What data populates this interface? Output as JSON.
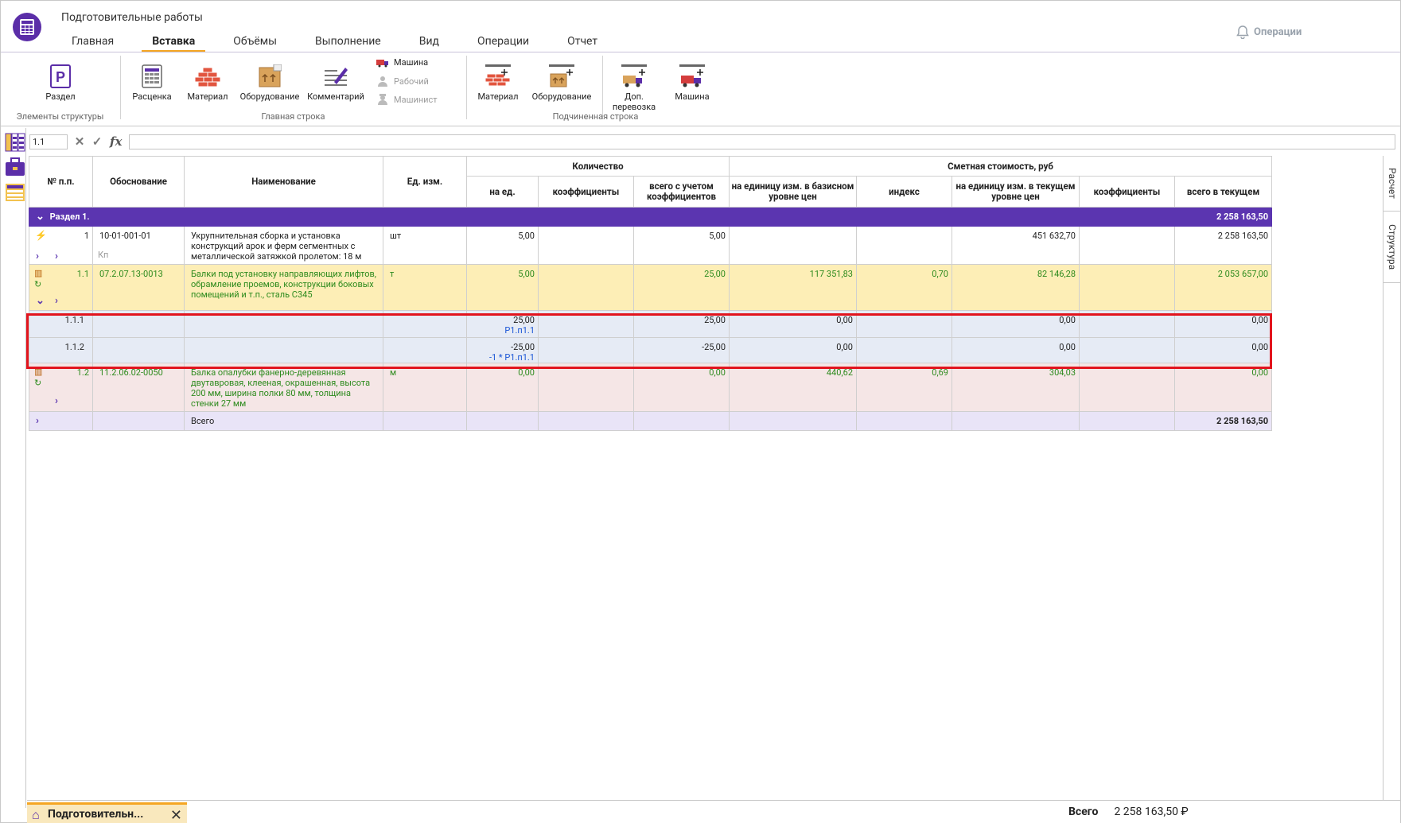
{
  "app": {
    "title": "Подготовительные работы"
  },
  "tabs": [
    "Главная",
    "Вставка",
    "Объёмы",
    "Выполнение",
    "Вид",
    "Операции",
    "Отчет"
  ],
  "operations_label": "Операции",
  "ribbon": {
    "section": "Раздел",
    "group1_label": "Элементы структуры",
    "rate": "Расценка",
    "material": "Материал",
    "equipment": "Оборудование",
    "comment": "Комментарий",
    "machine": "Машина",
    "worker": "Рабочий",
    "machinist": "Машинист",
    "group2_label": "Главная строка",
    "sub_material": "Материал",
    "sub_equipment": "Оборудование",
    "sub_transport": "Доп.\nперевозка",
    "sub_machine": "Машина",
    "group3_label": "Подчиненная строка"
  },
  "formula": {
    "cell_ref": "1.1",
    "value": ""
  },
  "right_tabs": [
    "Расчет",
    "Структура"
  ],
  "grid": {
    "headers": {
      "num": "№ п.п.",
      "basis": "Обоснование",
      "name": "Наименование",
      "unit": "Ед. изм.",
      "qty_group": "Количество",
      "qty_per": "на ед.",
      "qty_coef": "коэффициенты",
      "qty_total": "всего с учетом коэффициентов",
      "cost_group": "Сметная стоимость, руб",
      "cost_base": "на единицу изм. в базисном уровне цен",
      "cost_index": "индекс",
      "cost_cur": "на единицу изм. в текущем уровне цен",
      "cost_coef": "коэффициенты",
      "cost_total": "всего в текущем"
    },
    "section": {
      "title": "Раздел 1.",
      "total": "2 258 163,50"
    },
    "row1": {
      "num": "1",
      "basis": "10-01-001-01",
      "kp": "Кп",
      "name": "Укрупнительная сборка и установка конструкций арок и ферм сегментных с металлической затяжкой пролетом: 18 м",
      "unit": "шт",
      "qty_per": "5,00",
      "qty_total": "5,00",
      "cost_cur": "451 632,70",
      "total": "2 258 163,50"
    },
    "row11": {
      "num": "1.1",
      "basis": "07.2.07.13-0013",
      "name": "Балки под установку направляющих лифтов, обрамление проемов, конструкции боковых помещений и т.п., сталь С345",
      "unit": "т",
      "qty_per": "5,00",
      "qty_total": "25,00",
      "cost_base": "117 351,83",
      "index": "0,70",
      "cost_cur": "82 146,28",
      "total": "2 053 657,00"
    },
    "row111": {
      "num": "1.1.1",
      "qty_per": "25,00",
      "formula": "Р1.п1.1",
      "qty_total": "25,00",
      "cost_base": "0,00",
      "cost_cur": "0,00",
      "total": "0,00"
    },
    "row112": {
      "num": "1.1.2",
      "qty_per": "-25,00",
      "formula": "-1 * Р1.п1.1",
      "qty_total": "-25,00",
      "cost_base": "0,00",
      "cost_cur": "0,00",
      "total": "0,00"
    },
    "row12": {
      "num": "1.2",
      "basis": "11.2.06.02-0050",
      "name": "Балка опалубки фанерно-деревянная двутавровая, клееная, окрашенная, высота 200 мм, ширина полки 80 мм, толщина стенки 27 мм",
      "unit": "м",
      "qty_per": "0,00",
      "qty_total": "0,00",
      "cost_base": "440,62",
      "index": "0,69",
      "cost_cur": "304,03",
      "total": "0,00"
    },
    "total_row": {
      "label": "Всего",
      "total": "2 258 163,50"
    }
  },
  "bottom": {
    "doc_tab": "Подготовительн...",
    "total_label": "Всего",
    "total_value": "2 258 163,50 ₽"
  },
  "colors": {
    "accent": "#f5a623",
    "section": "#5b35b0",
    "highlight": "#e2141d",
    "green_text": "#2e8b1e"
  }
}
